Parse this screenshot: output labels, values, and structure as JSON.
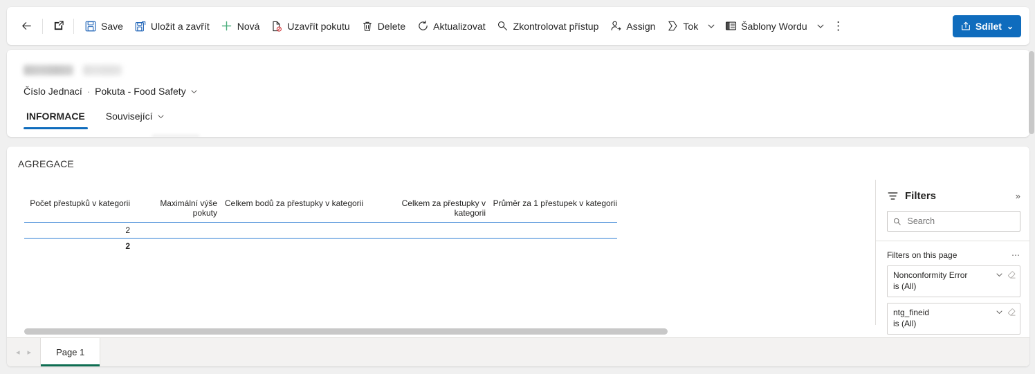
{
  "commandbar": {
    "back_icon": "arrow-left-icon",
    "popout_icon": "open-in-new-window-icon",
    "items": [
      {
        "label": "Save",
        "icon": "save-icon"
      },
      {
        "label": "Uložit a zavřít",
        "icon": "save-and-close-icon"
      },
      {
        "label": "Nová",
        "icon": "plus-icon"
      },
      {
        "label": "Uzavřít pokutu",
        "icon": "close-fine-icon"
      },
      {
        "label": "Delete",
        "icon": "trash-icon"
      },
      {
        "label": "Aktualizovat",
        "icon": "refresh-icon"
      },
      {
        "label": "Zkontrolovat přístup",
        "icon": "key-icon"
      },
      {
        "label": "Assign",
        "icon": "assign-user-icon"
      },
      {
        "label": "Tok",
        "icon": "flow-icon",
        "chevron": true
      },
      {
        "label": "Šablony Wordu",
        "icon": "word-template-icon",
        "chevron": true
      }
    ],
    "overflow_label": "⋮",
    "share": {
      "label": "Sdílet",
      "icon": "share-icon",
      "chevron": "⌄",
      "color": "#0f6cbd"
    }
  },
  "record": {
    "title_redacted": true,
    "breadcrumb": {
      "field": "Číslo Jednací",
      "separator": "·",
      "entity": "Pokuta - Food Safety",
      "chevron_icon": "chevron-down-icon"
    },
    "tabs": [
      {
        "label": "INFORMACE",
        "active": true
      },
      {
        "label": "Související",
        "active": false,
        "chevron_icon": "chevron-down-icon"
      }
    ]
  },
  "report": {
    "title": "AGREGACE",
    "page_tab": "Page 1",
    "nav_prev_icon": "triangle-left-icon",
    "nav_next_icon": "triangle-right-icon",
    "accent_underline": "#0e6e52",
    "rule_color": "#2b7cd3",
    "matrix": {
      "columns": [
        "Počet přestupků v kategorii",
        "Maximální výše pokuty",
        "Celkem bodů za přestupky v kategorii",
        "Celkem za přestupky v kategorii",
        "Průměr za 1 přestupek v kategorii"
      ],
      "sorted_column_index": 4,
      "sort_direction": "desc",
      "rows": [
        [
          "2",
          "",
          "",
          "",
          ""
        ]
      ],
      "total_row": [
        "2",
        "",
        "",
        "",
        ""
      ]
    }
  },
  "filters": {
    "title": "Filters",
    "filter_icon": "filter-icon",
    "expand_icon": "chevrons-right-icon",
    "search": {
      "placeholder": "Search",
      "value": "",
      "icon": "search-icon"
    },
    "section_label": "Filters on this page",
    "section_more": "⋯",
    "cards": [
      {
        "name": "Nonconformity Error",
        "value": "is (All)",
        "chevron_icon": "chevron-down-icon",
        "erase_icon": "eraser-icon"
      },
      {
        "name": "ntg_fineid",
        "value": "is (All)",
        "chevron_icon": "chevron-down-icon",
        "erase_icon": "eraser-icon"
      }
    ]
  }
}
